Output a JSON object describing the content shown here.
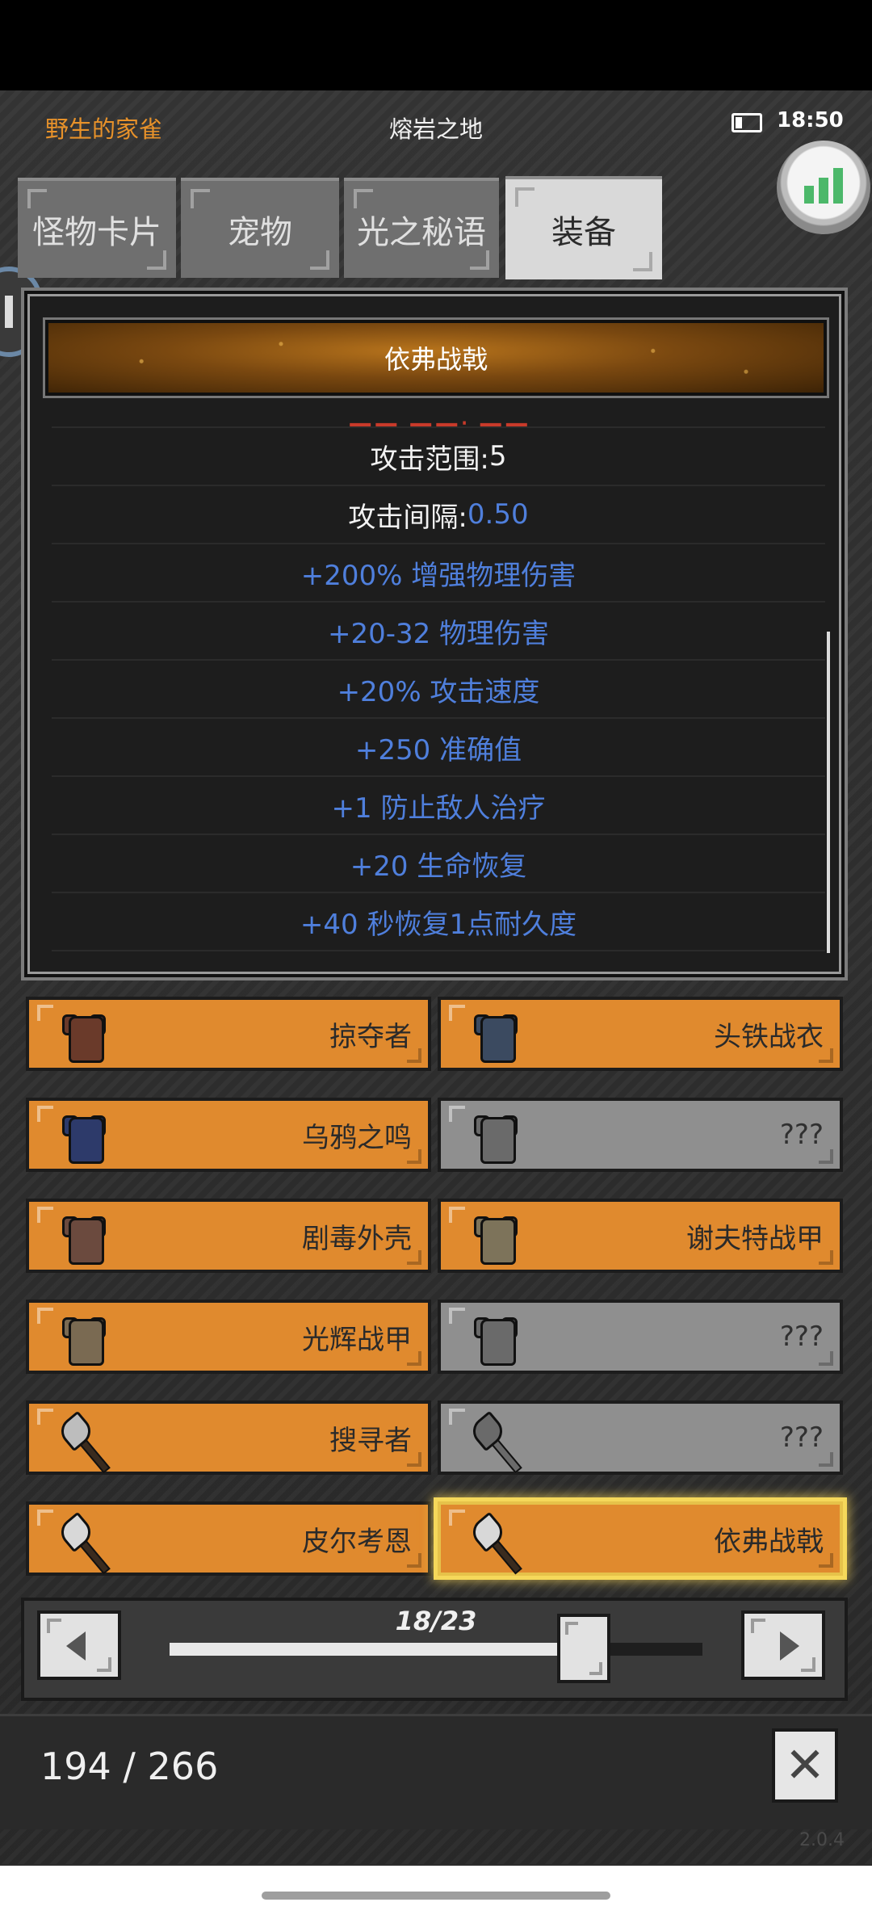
{
  "header": {
    "player_name": "野生的家雀",
    "location": "熔岩之地",
    "time": "18:50"
  },
  "tabs": [
    {
      "label": "怪物卡片",
      "active": false
    },
    {
      "label": "宠物",
      "active": false
    },
    {
      "label": "光之秘语",
      "active": false
    },
    {
      "label": "装备",
      "active": true
    }
  ],
  "detail": {
    "title": "依弗战戟",
    "stats": [
      {
        "label": "攻击范围: ",
        "value": "5"
      },
      {
        "label": "攻击间隔: ",
        "value": "0.50"
      }
    ],
    "bonuses": [
      "+200% 增强物理伤害",
      "+20-32 物理伤害",
      "+20% 攻击速度",
      "+250 准确值",
      "+1 防止敌人治疗",
      "+20 生命恢复",
      "+40 秒恢复1点耐久度"
    ]
  },
  "items": [
    {
      "name": "掠夺者",
      "status": "owned",
      "icon": "armor-icon",
      "color": "#6a3a2a"
    },
    {
      "name": "头铁战衣",
      "status": "owned",
      "icon": "armor-icon",
      "color": "#3b4a60"
    },
    {
      "name": "乌鸦之鸣",
      "status": "owned",
      "icon": "armor-icon",
      "color": "#2d3a6a"
    },
    {
      "name": "???",
      "status": "locked",
      "icon": "armor-icon",
      "color": "#6a6a6a"
    },
    {
      "name": "剧毒外壳",
      "status": "owned",
      "icon": "armor-icon",
      "color": "#6b4a3e"
    },
    {
      "name": "谢夫特战甲",
      "status": "owned",
      "icon": "armor-icon",
      "color": "#7d735a"
    },
    {
      "name": "光辉战甲",
      "status": "owned",
      "icon": "armor-icon",
      "color": "#7a6a52"
    },
    {
      "name": "???",
      "status": "locked",
      "icon": "armor-icon",
      "color": "#6a6a6a"
    },
    {
      "name": "搜寻者",
      "status": "owned",
      "icon": "axe-icon",
      "color": "#bdbdbd"
    },
    {
      "name": "???",
      "status": "locked",
      "icon": "axe-icon",
      "color": "#6a6a6a"
    },
    {
      "name": "皮尔考恩",
      "status": "owned",
      "icon": "axe-icon",
      "color": "#d8d8d8"
    },
    {
      "name": "依弗战戟",
      "status": "selected",
      "icon": "axe-icon",
      "color": "#d8d8d8"
    }
  ],
  "pager": {
    "label": "18/23",
    "current": 18,
    "total": 23
  },
  "collection": {
    "count": "194 / 266"
  },
  "version": "2.0.4",
  "colors": {
    "accent": "#e08a2e",
    "locked": "#8f8f8f",
    "bonus_text": "#4f7fdc",
    "player_name": "#e8922a"
  }
}
